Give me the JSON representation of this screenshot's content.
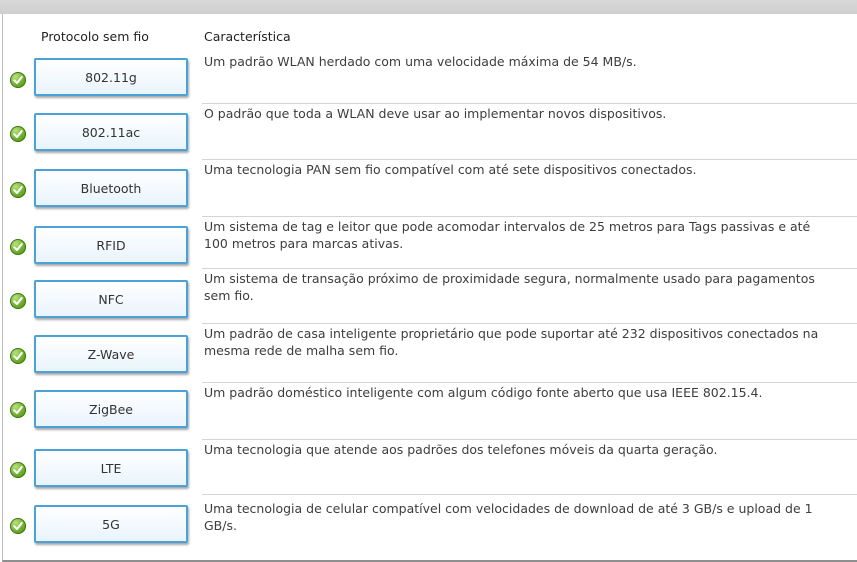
{
  "header": {
    "protocol_col": "Protocolo sem fio",
    "characteristic_col": "Característica"
  },
  "rows": [
    {
      "protocol": "802.11g",
      "desc1": "Um padrão WLAN herdado com uma velocidade máxima de 54 MB/s.",
      "desc2": ""
    },
    {
      "protocol": "802.11ac",
      "desc1": "O padrão que toda a WLAN deve usar ao implementar novos dispositivos.",
      "desc2": ""
    },
    {
      "protocol": "Bluetooth",
      "desc1": "Uma tecnologia PAN sem fio compatível com até sete dispositivos conectados.",
      "desc2": ""
    },
    {
      "protocol": "RFID",
      "desc1": "Um sistema de tag e leitor que pode acomodar intervalos de 25 metros para Tags passivas e até",
      "desc2": "100 metros para marcas ativas."
    },
    {
      "protocol": "NFC",
      "desc1": "Um sistema de transação próximo de proximidade segura, normalmente usado para pagamentos",
      "desc2": "sem fio."
    },
    {
      "protocol": "Z-Wave",
      "desc1": "Um padrão de casa inteligente proprietário que pode suportar até 232 dispositivos conectados na",
      "desc2": "mesma rede de malha sem fio."
    },
    {
      "protocol": "ZigBee",
      "desc1": "Um padrão doméstico inteligente com algum código fonte aberto que usa IEEE 802.15.4.",
      "desc2": ""
    },
    {
      "protocol": "LTE",
      "desc1": "Uma tecnologia que atende aos padrões dos telefones móveis da quarta geração.",
      "desc2": ""
    },
    {
      "protocol": "5G",
      "desc1": "Uma tecnologia de celular compatível com velocidades de download de até 3 GB/s e upload de 1",
      "desc2": "GB/s."
    }
  ],
  "colors": {
    "box_border": "#4aa2d8",
    "check_green": "#6aa82a",
    "divider": "#d4d4d4"
  }
}
